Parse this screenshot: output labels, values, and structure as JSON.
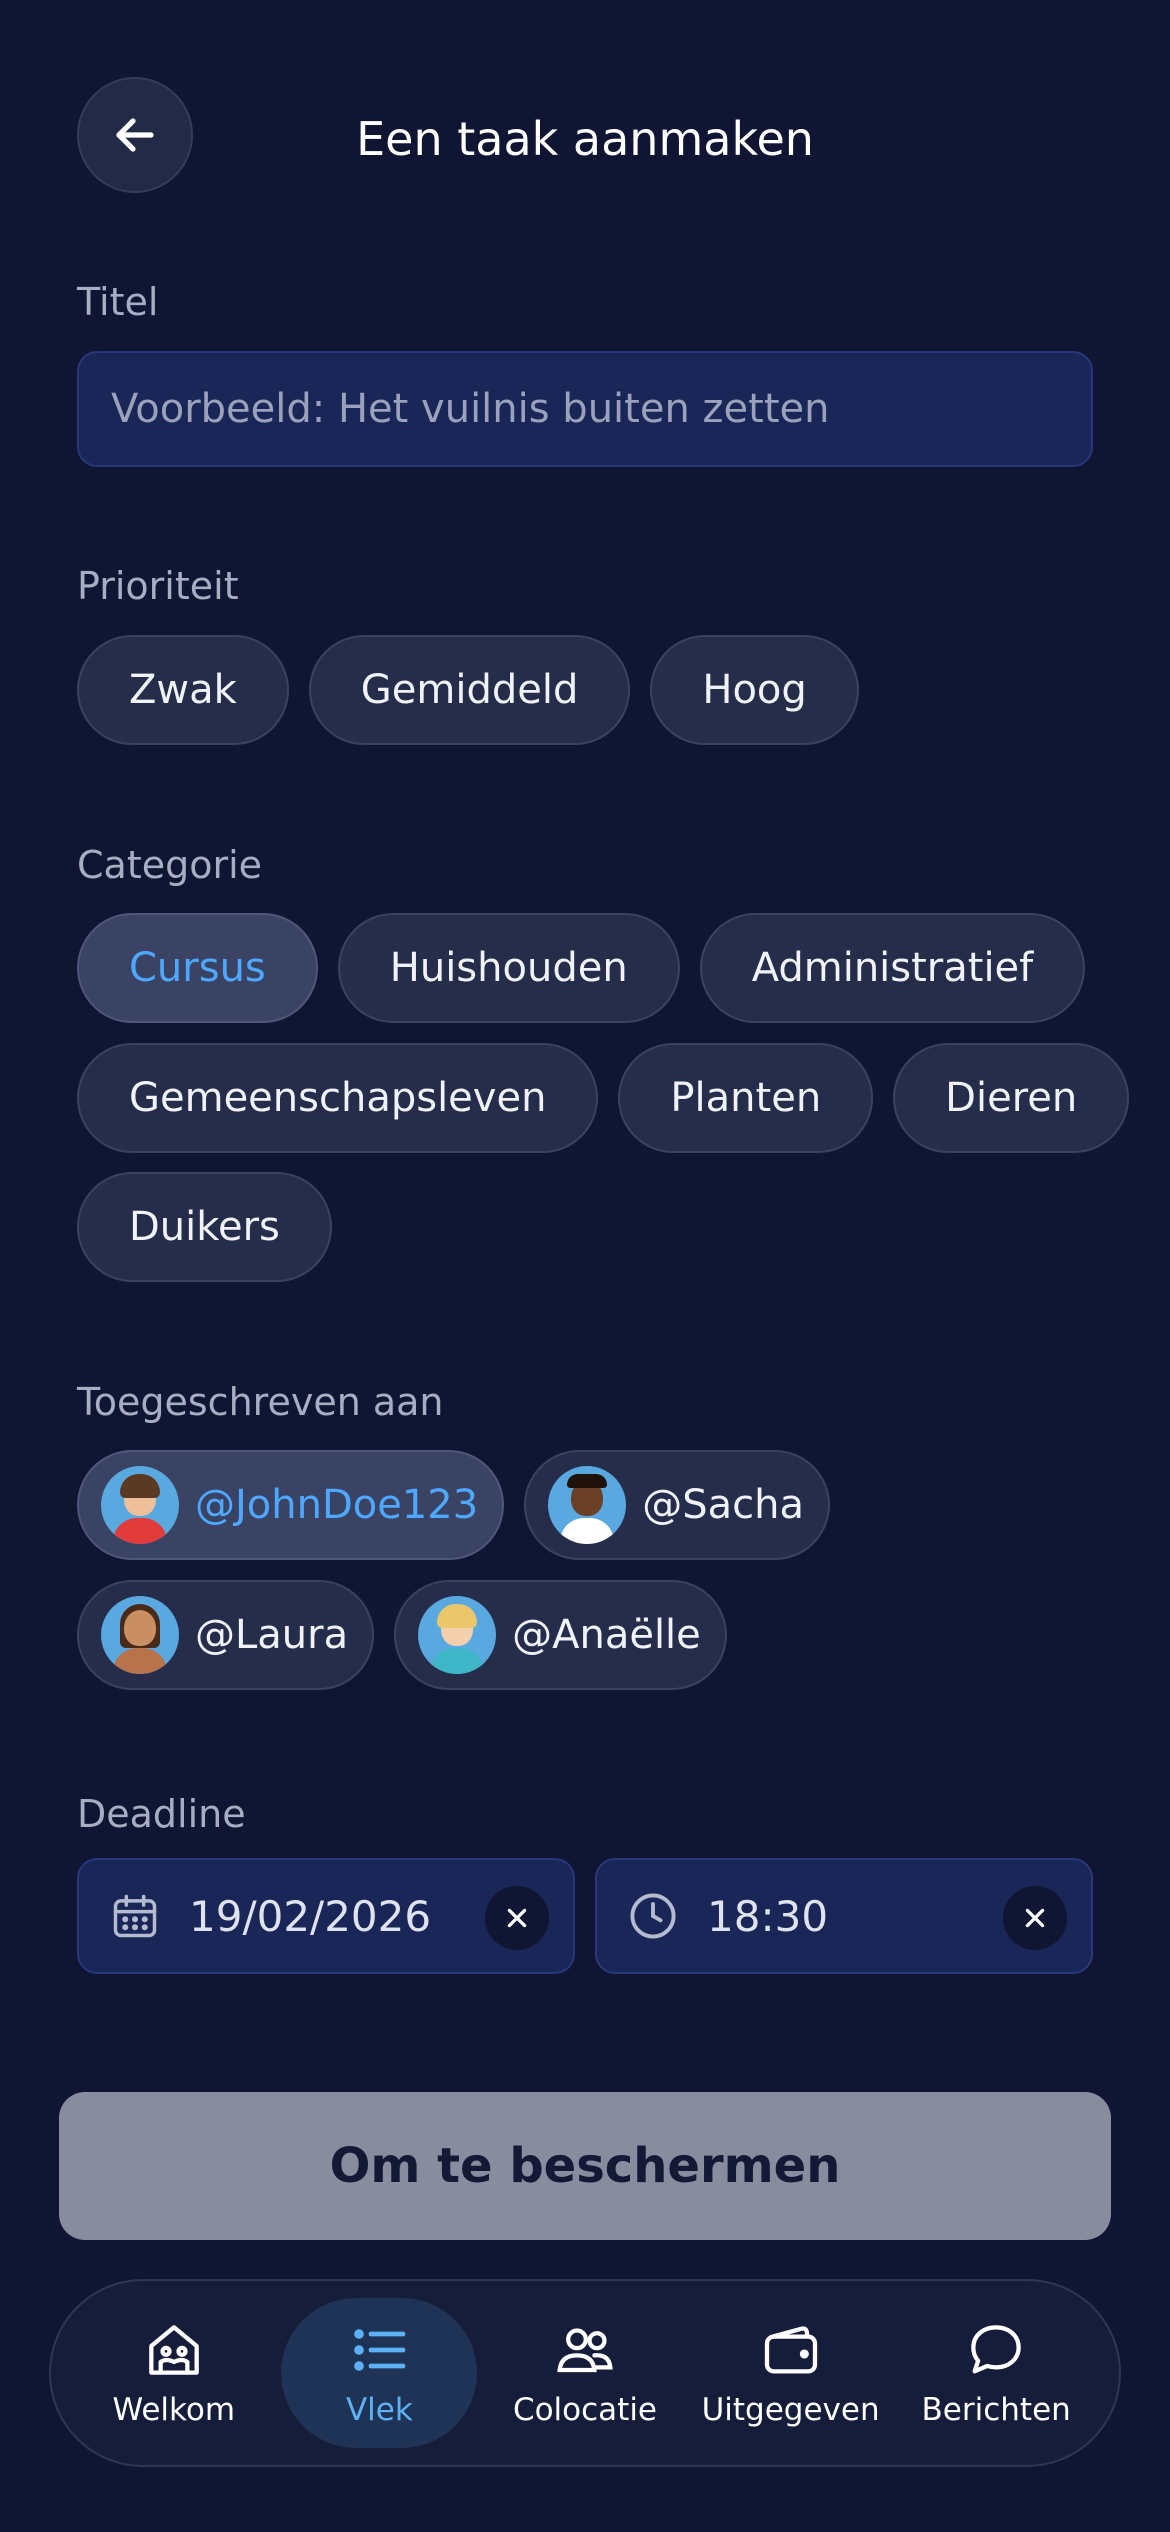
{
  "header": {
    "title": "Een taak aanmaken",
    "back_icon": "arrow-left-icon"
  },
  "title_section": {
    "label": "Titel",
    "placeholder": "Voorbeeld: Het vuilnis buiten zetten",
    "value": ""
  },
  "priority": {
    "label": "Prioriteit",
    "options": [
      "Zwak",
      "Gemiddeld",
      "Hoog"
    ]
  },
  "category": {
    "label": "Categorie",
    "selected": "Cursus",
    "options": [
      "Cursus",
      "Huishouden",
      "Administratief",
      "Gemeenschapsleven",
      "Planten",
      "Dieren",
      "Duikers"
    ]
  },
  "assigned": {
    "label": "Toegeschreven aan",
    "selected": "@JohnDoe123",
    "users": [
      "@JohnDoe123",
      "@Sacha",
      "@Laura",
      "@Anaëlle"
    ]
  },
  "deadline": {
    "label": "Deadline",
    "date": "19/02/2026",
    "time": "18:30",
    "date_icon": "calendar-icon",
    "time_icon": "clock-icon"
  },
  "submit": {
    "label": "Om te beschermen"
  },
  "nav": {
    "active": "Vlek",
    "items": [
      {
        "label": "Welkom",
        "icon": "home-icon"
      },
      {
        "label": "Vlek",
        "icon": "list-icon"
      },
      {
        "label": "Colocatie",
        "icon": "users-icon"
      },
      {
        "label": "Uitgegeven",
        "icon": "wallet-icon"
      },
      {
        "label": "Berichten",
        "icon": "chat-icon"
      }
    ]
  },
  "colors": {
    "background": "#0f1533",
    "accent": "#4ea8ff",
    "input_bg": "#1a2657",
    "chip_bg": "#262d4a",
    "button_disabled": "#878c9f"
  }
}
